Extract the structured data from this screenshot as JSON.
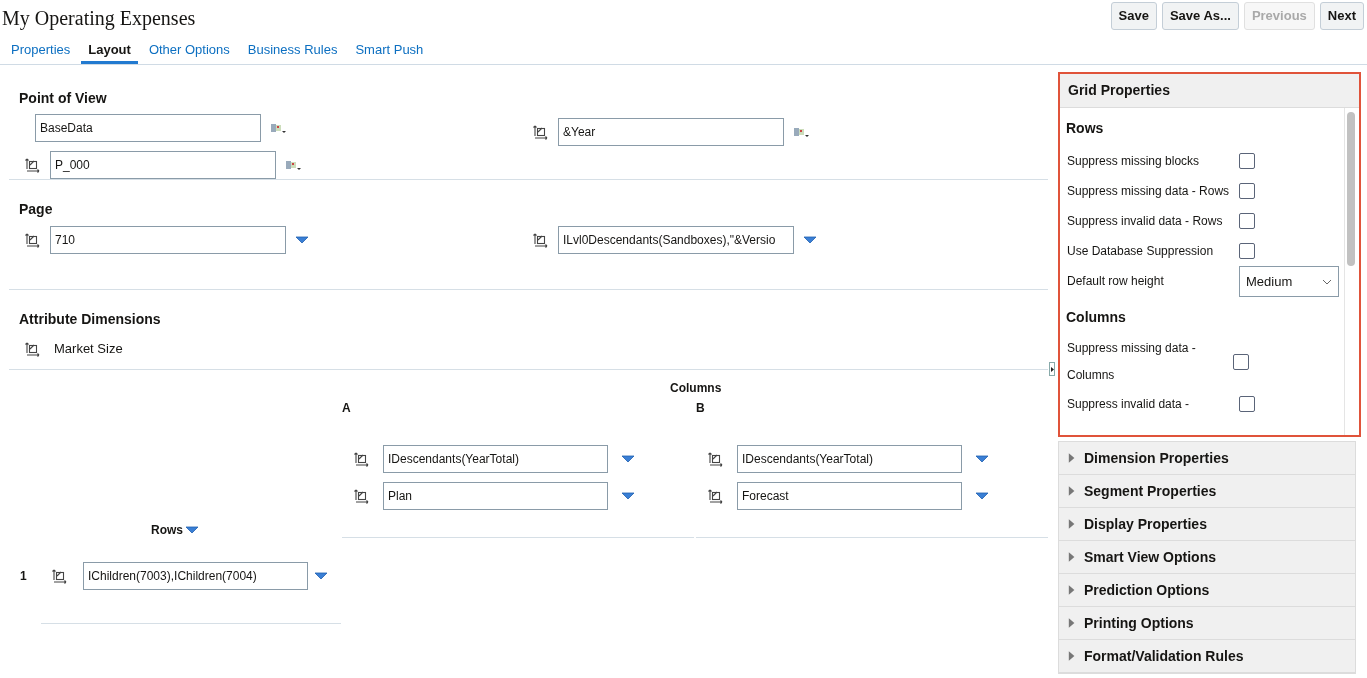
{
  "title": "My Operating Expenses",
  "buttons": [
    {
      "label": "Save",
      "disabled": false
    },
    {
      "label": "Save As...",
      "disabled": false
    },
    {
      "label": "Previous",
      "disabled": true
    },
    {
      "label": "Next",
      "disabled": false
    }
  ],
  "tabs": [
    {
      "label": "Properties",
      "selected": false
    },
    {
      "label": "Layout",
      "selected": true
    },
    {
      "label": "Other Options",
      "selected": false
    },
    {
      "label": "Business Rules",
      "selected": false
    },
    {
      "label": "Smart Push",
      "selected": false
    }
  ],
  "point_of_view": {
    "heading": "Point of View",
    "members": [
      {
        "value": "BaseData",
        "pivot_icon": false
      },
      {
        "value": "&Year",
        "pivot_icon": true
      },
      {
        "value": "P_000",
        "pivot_icon": true
      }
    ]
  },
  "page": {
    "heading": "Page",
    "members": [
      {
        "value": "710"
      },
      {
        "value": "ILvl0Descendants(Sandboxes),\"&Versio"
      }
    ]
  },
  "attribute_dimensions": {
    "heading": "Attribute Dimensions",
    "items": [
      "Market Size"
    ]
  },
  "layout_grid": {
    "columns_label": "Columns",
    "rows_label": "Rows",
    "columns": [
      {
        "label": "A",
        "members": [
          "IDescendants(YearTotal)",
          "Plan"
        ]
      },
      {
        "label": "B",
        "members": [
          "IDescendants(YearTotal)",
          "Forecast"
        ]
      }
    ],
    "rows": [
      {
        "label": "1",
        "members": [
          "IChildren(7003),IChildren(7004)"
        ]
      }
    ]
  },
  "grid_properties": {
    "title": "Grid Properties",
    "expanded": true,
    "sections": [
      {
        "heading": "Rows",
        "options": [
          {
            "kind": "checkbox",
            "label": "Suppress missing blocks",
            "checked": false
          },
          {
            "kind": "checkbox",
            "label": "Suppress missing data - Rows",
            "checked": false
          },
          {
            "kind": "checkbox",
            "label": "Suppress invalid data - Rows",
            "checked": false
          },
          {
            "kind": "checkbox",
            "label": "Use Database Suppression",
            "checked": false
          },
          {
            "kind": "select",
            "label": "Default row height",
            "value": "Medium"
          }
        ]
      },
      {
        "heading": "Columns",
        "options": [
          {
            "kind": "checkbox",
            "label": "Suppress missing data - Columns",
            "checked": false
          },
          {
            "kind": "checkbox",
            "label": "Suppress invalid data -",
            "checked": false
          }
        ]
      }
    ]
  },
  "other_panels": [
    {
      "title": "Dimension Properties",
      "expanded": false
    },
    {
      "title": "Segment Properties",
      "expanded": false
    },
    {
      "title": "Display Properties",
      "expanded": false
    },
    {
      "title": "Smart View Options",
      "expanded": false
    },
    {
      "title": "Prediction Options",
      "expanded": false
    },
    {
      "title": "Printing Options",
      "expanded": false
    },
    {
      "title": "Format/Validation Rules",
      "expanded": false
    }
  ]
}
